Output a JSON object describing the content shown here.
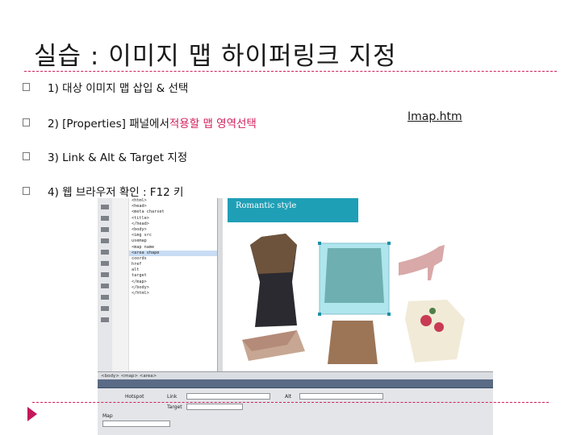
{
  "slide": {
    "title": "실습 : 이미지 맵 하이퍼링크 지정",
    "link_text": "Imap.htm",
    "bullets": [
      {
        "text": "1) 대상 이미지 맵 삽입 & 선택",
        "highlight": ""
      },
      {
        "text": "2) [Properties] 패널에서 ",
        "highlight": "적용할 맵 영역선택"
      },
      {
        "text": "3) Link & Alt & Target 지정",
        "highlight": ""
      },
      {
        "text": "4) 웹 브라우저 확인 :  F12 키",
        "highlight": ""
      }
    ],
    "accent_color": "#d21e5a"
  },
  "screenshot": {
    "code_lines": [
      "<html>",
      "<head>",
      "<meta charset",
      "<title>",
      "</head>",
      "<body>",
      "<img src",
      "usemap",
      "<map name",
      "<area shape",
      "coords",
      "href",
      "alt",
      "target",
      "</map>",
      "</body>",
      "</html>"
    ],
    "selected_line": 9,
    "banner": {
      "title": "Romantic style",
      "subtitle": "",
      "color": "#1f9fb6"
    },
    "status": "<body> <map> <area>",
    "properties": {
      "hotspot_label": "Hotspot",
      "link_label": "Link",
      "target_label": "Target",
      "alt_label": "Alt",
      "map_label": "Map"
    }
  }
}
